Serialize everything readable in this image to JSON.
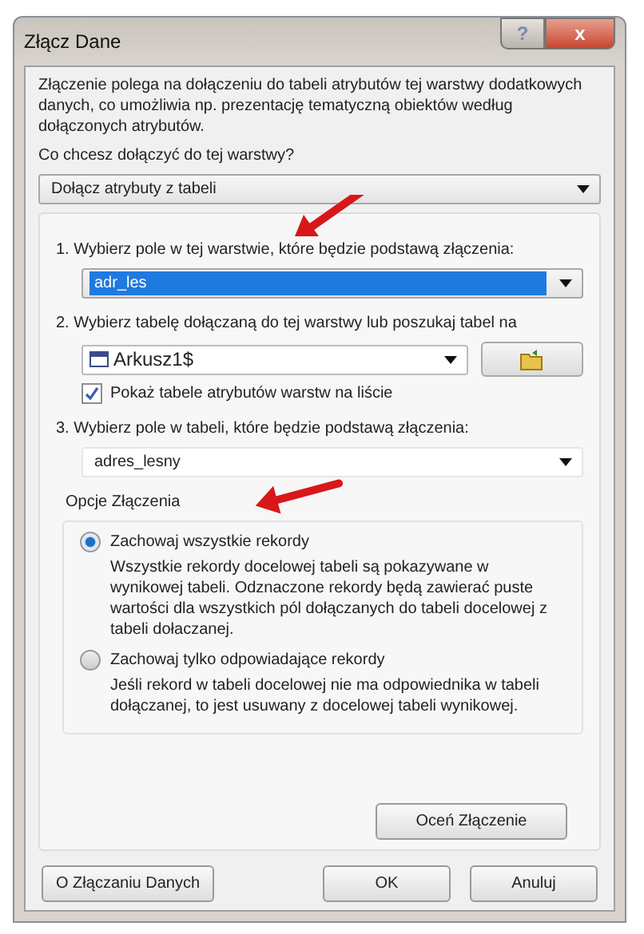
{
  "window": {
    "title": "Złącz Dane",
    "help_button": "?",
    "close_button": "x"
  },
  "description": "Złączenie polega na dołączeniu do tabeli atrybutów tej warstwy dodatkowych danych, co umożliwia np. prezentację tematyczną obiektów według dołączonych atrybutów.",
  "question": "Co chcesz dołączyć do tej warstwy?",
  "join_type": {
    "value": "Dołącz atrybuty z tabeli"
  },
  "steps": [
    {
      "kind": "select",
      "label": "1. Wybierz pole w tej warstwie, które będzie podstawą złączenia:",
      "value": "adr_les",
      "selected": true
    },
    {
      "kind": "table-select",
      "label": "2. Wybierz tabelę dołączaną do tej warstwy lub poszukaj tabel na",
      "value": "Arkusz1$",
      "checkbox": {
        "label": "Pokaż tabele atrybutów warstw na liście",
        "checked": true
      }
    },
    {
      "kind": "select",
      "label": "3. Wybierz pole w tabeli, które będzie podstawą złączenia:",
      "value": "adres_lesny",
      "selected": false
    }
  ],
  "join_options": {
    "title": "Opcje Złączenia",
    "options": [
      {
        "label": "Zachowaj wszystkie rekordy",
        "description": "Wszystkie rekordy docelowej tabeli są pokazywane w wynikowej tabeli. Odznaczone rekordy będą zawierać puste wartości dla wszystkich pól dołączanych do tabeli docelowej z tabeli dołaczanej.",
        "selected": true
      },
      {
        "label": "Zachowaj tylko odpowiadające rekordy",
        "description": "Jeśli rekord w tabeli docelowej nie ma odpowiednika w tabeli dołączanej, to jest usuwany z docelowej tabeli wynikowej.",
        "selected": false
      }
    ]
  },
  "evaluate_button": "Oceń Złączenie",
  "footer": {
    "about_button": "O Złączaniu Danych",
    "buttons": [
      "OK",
      "Anuluj"
    ]
  }
}
